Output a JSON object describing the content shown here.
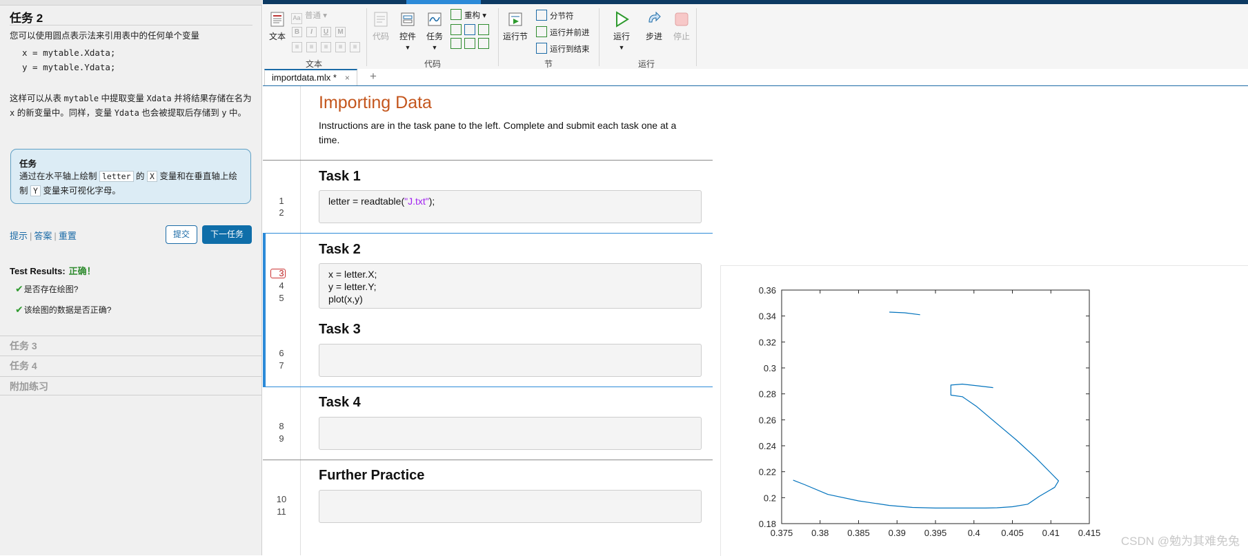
{
  "task_pane": {
    "title": "任务 2",
    "intro": "您可以使用圆点表示法来引用表中的任何单个变量",
    "code_lines": [
      "x = mytable.Xdata;",
      "y = mytable.Ydata;"
    ],
    "explanation": {
      "p1": "这样可以从表 ",
      "c1": "mytable",
      "p2": " 中提取变量 ",
      "c2": "Xdata",
      "p3": " 并将结果存储在名为 ",
      "c3": "x",
      "p4": " 的新变量中。同样，变量 ",
      "c4": "Ydata",
      "p5": " 也会被提取后存储到 ",
      "c5": "y",
      "p6": " 中。"
    },
    "task_box": {
      "header": "任务",
      "p1": "通过在水平轴上绘制 ",
      "k1": "letter",
      "p2": " 的 ",
      "k2": "X",
      "p3": " 变量和在垂直轴上绘制 ",
      "k3": "Y",
      "p4": " 变量来可视化字母。"
    },
    "links": {
      "hint": "提示",
      "answer": "答案",
      "reset": "重置"
    },
    "submit_label": "提交",
    "next_label": "下一任务",
    "test_results_label": "Test Results:",
    "test_results_status": "正确！",
    "checks": [
      "是否存在绘图?",
      "该绘图的数据是否正确?"
    ],
    "collapsed_tasks": [
      "任务 3",
      "任务 4",
      "附加练习"
    ]
  },
  "toolbar": {
    "text_label": "文本",
    "style_label": "普通",
    "text_group": "文本",
    "code_label": "代码",
    "control_label": "控件",
    "task_label": "任务",
    "refactor_label": "重构",
    "code_group": "代码",
    "run_section_label": "运行节",
    "section_break_label": "分节符",
    "run_and_advance_label": "运行并前进",
    "run_to_end_label": "运行到结束",
    "section_group": "节",
    "run_label": "运行",
    "step_label": "步进",
    "stop_label": "停止",
    "run_group": "运行"
  },
  "doc_tab": {
    "name": "importdata.mlx *",
    "close": "×",
    "add": "+"
  },
  "editor": {
    "title": "Importing Data",
    "instructions": "Instructions are in the task pane to the left. Complete and submit each task one at a time.",
    "sections": [
      {
        "title": "Task 1",
        "lines": [
          "1",
          "2"
        ]
      },
      {
        "title": "Task 2",
        "lines": [
          "3",
          "4",
          "5"
        ]
      },
      {
        "title": "Task 3",
        "lines": [
          "6",
          "7"
        ]
      },
      {
        "title": "Task 4",
        "lines": [
          "8",
          "9"
        ]
      },
      {
        "title": "Further Practice",
        "lines": [
          "10",
          "11"
        ]
      }
    ],
    "task1_code": {
      "pre": "letter = readtable(",
      "str": "\"J.txt\"",
      "post": ");"
    },
    "task2_code": [
      "x = letter.X;",
      "y = letter.Y;",
      "plot(x,y)"
    ]
  },
  "chart_data": {
    "type": "line",
    "title": "",
    "xlabel": "",
    "ylabel": "",
    "xlim": [
      0.375,
      0.415
    ],
    "ylim": [
      0.18,
      0.36
    ],
    "xticks": [
      "0.375",
      "0.38",
      "0.385",
      "0.39",
      "0.395",
      "0.4",
      "0.405",
      "0.41",
      "0.415"
    ],
    "yticks": [
      "0.18",
      "0.2",
      "0.22",
      "0.24",
      "0.26",
      "0.28",
      "0.3",
      "0.32",
      "0.34",
      "0.36"
    ],
    "grid": false,
    "line_color": "#0072bd",
    "series": [
      {
        "segment": "top",
        "x": [
          0.389,
          0.391,
          0.393
        ],
        "y": [
          0.343,
          0.3425,
          0.341
        ]
      },
      {
        "segment": "main",
        "x": [
          0.3765,
          0.378,
          0.381,
          0.385,
          0.389,
          0.392,
          0.395,
          0.398,
          0.4015,
          0.403,
          0.405,
          0.407,
          0.4085,
          0.4105,
          0.411,
          0.41,
          0.408,
          0.4055,
          0.4025,
          0.4003,
          0.3985,
          0.397,
          0.397,
          0.3985,
          0.4005,
          0.4025
        ],
        "y": [
          0.2135,
          0.21,
          0.2025,
          0.1975,
          0.194,
          0.1925,
          0.192,
          0.192,
          0.192,
          0.1922,
          0.193,
          0.195,
          0.201,
          0.208,
          0.213,
          0.219,
          0.231,
          0.2445,
          0.2595,
          0.2705,
          0.2778,
          0.279,
          0.2868,
          0.2875,
          0.2862,
          0.2848
        ]
      }
    ],
    "colors": {
      "axis": "#262626"
    }
  },
  "watermark": "CSDN @勉为其难免兔"
}
